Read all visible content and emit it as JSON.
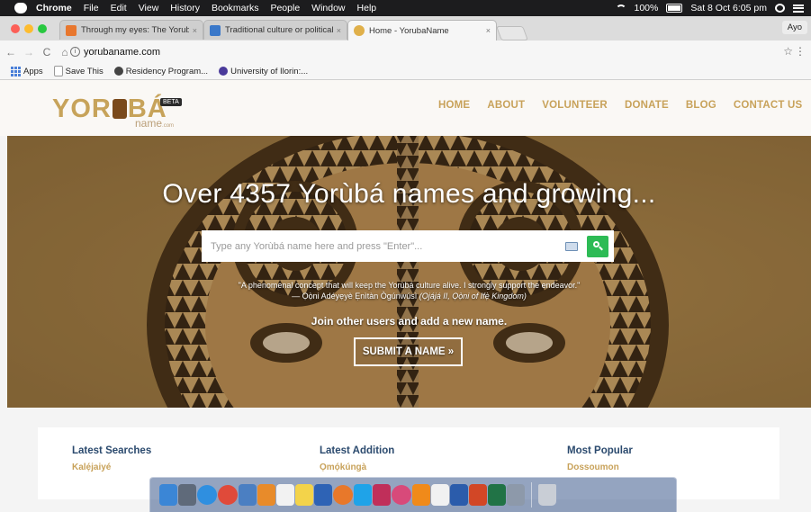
{
  "menubar": {
    "app": "Chrome",
    "items": [
      "File",
      "Edit",
      "View",
      "History",
      "Bookmarks",
      "People",
      "Window",
      "Help"
    ],
    "battery": "100%",
    "datetime": "Sat 8 Oct 6:05 pm"
  },
  "tabs": [
    {
      "title": "Through my eyes: The Yoruba",
      "close": "×",
      "favicon_color": "#e8772e"
    },
    {
      "title": "Traditional culture or political",
      "close": "×",
      "favicon_color": "#3a78c9"
    },
    {
      "title": "Home - YorubaName",
      "close": "×",
      "favicon_color": "#e0b04a"
    }
  ],
  "profile": "Ayo",
  "toolbar": {
    "back": "←",
    "forward": "→",
    "reload": "C",
    "home": "⌂",
    "url": "yorubaname.com",
    "star": "☆",
    "menu": "⋮"
  },
  "bookmarks": [
    {
      "label": "Apps"
    },
    {
      "label": "Save This"
    },
    {
      "label": "Residency Program..."
    },
    {
      "label": "University of Ilorin:..."
    }
  ],
  "site": {
    "logo_text_left": "YOR",
    "logo_text_right": "BÁ",
    "beta": "BETA",
    "logo_sub": "name",
    "logo_sub_small": ".com",
    "nav": [
      "HOME",
      "ABOUT",
      "VOLUNTEER",
      "DONATE",
      "BLOG",
      "CONTACT US"
    ]
  },
  "hero": {
    "title": "Over 4357 Yorùbá names and growing...",
    "search_placeholder": "Type any Yorùbá name here and press \"Enter\"...",
    "quote_line1": "\"A phenomenal concept that will keep the Yorùbá culture alive. I strongly support the endeavor.\"",
    "quote_line2_name": "— Ọọ̀ni Adéyẹyè Ẹnìtàn Ògúnwúsì",
    "quote_line2_title": "(Ọjájá II, Ọọ̀ni of Ifẹ̀ Kingdom)",
    "join": "Join other users and add a new name.",
    "submit": "SUBMIT A NAME »"
  },
  "lists": [
    {
      "heading": "Latest Searches",
      "first": "Kalẹ́jaiyé"
    },
    {
      "heading": "Latest Addition",
      "first": "Ọmọ́kúngà"
    },
    {
      "heading": "Most Popular",
      "first": "Dossoumon"
    }
  ],
  "dock": {
    "icons": [
      {
        "name": "finder-icon",
        "color": "#3b86d6"
      },
      {
        "name": "launchpad-icon",
        "color": "#5f6a7a"
      },
      {
        "name": "safari-icon",
        "color": "#2f8fe0"
      },
      {
        "name": "chrome-icon",
        "color": "#e04a3a"
      },
      {
        "name": "preview-icon",
        "color": "#4b7fc2"
      },
      {
        "name": "ibooks-icon",
        "color": "#e88b2a"
      },
      {
        "name": "calendar-icon",
        "color": "#f2f2f2"
      },
      {
        "name": "notes-icon",
        "color": "#f3d34a"
      },
      {
        "name": "mail-icon",
        "color": "#2e63b5"
      },
      {
        "name": "firefox-icon",
        "color": "#e8782a"
      },
      {
        "name": "skype-icon",
        "color": "#1fa3e8"
      },
      {
        "name": "illustrator-icon",
        "color": "#c02f5a"
      },
      {
        "name": "color-wheel-icon",
        "color": "#d84a7a"
      },
      {
        "name": "vlc-icon",
        "color": "#f08a1a"
      },
      {
        "name": "textedit-icon",
        "color": "#f1f1f1"
      },
      {
        "name": "word-icon",
        "color": "#2b5cab"
      },
      {
        "name": "powerpoint-icon",
        "color": "#d24726"
      },
      {
        "name": "excel-icon",
        "color": "#217346"
      },
      {
        "name": "system-prefs-icon",
        "color": "#8d99aa"
      }
    ],
    "trash": {
      "name": "trash-icon",
      "color": "#c9ced6"
    }
  }
}
